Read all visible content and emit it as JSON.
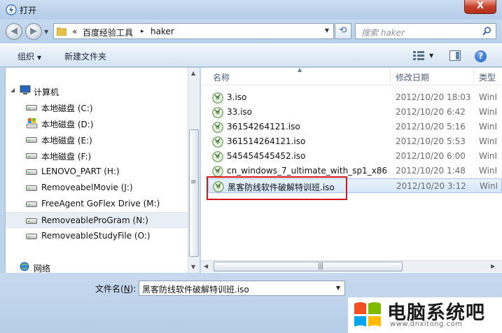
{
  "window": {
    "title": "打开",
    "close_glyph": "X"
  },
  "address": {
    "prefix": "«",
    "crumbs": [
      "百度经验工具",
      "haker"
    ],
    "separator": "▸",
    "search_placeholder": "搜索 haker"
  },
  "toolbar": {
    "organize_label": "组织",
    "new_folder_label": "新建文件夹",
    "help_glyph": "?"
  },
  "nav": {
    "computer": "计算机",
    "drives": [
      "本地磁盘 (C:)",
      "本地磁盘 (D:)",
      "本地磁盘 (E:)",
      "本地磁盘 (F:)",
      "LENOVO_PART (H:)",
      "RemoveabelMovie (J:)",
      "FreeAgent GoFlex Drive (M:)",
      "RemoveableProGram (N:)",
      "RemoveableStudyFile (O:)"
    ],
    "network": "网络"
  },
  "columns": {
    "name": "名称",
    "date": "修改日期",
    "type": "类型"
  },
  "files": [
    {
      "name": "3.iso",
      "date": "2012/10/20 18:03",
      "type": "WinI"
    },
    {
      "name": "33.iso",
      "date": "2012/10/20 6:42",
      "type": "WinI"
    },
    {
      "name": "36154264121.iso",
      "date": "2012/10/20 5:16",
      "type": "WinI"
    },
    {
      "name": "361514264121.iso",
      "date": "2012/10/20 5:53",
      "type": "WinI"
    },
    {
      "name": "545454545452.iso",
      "date": "2012/10/20 6:00",
      "type": "WinI"
    },
    {
      "name": "cn_windows_7_ultimate_with_sp1_x86_...",
      "date": "2012/10/20 1:48",
      "type": "WinI"
    },
    {
      "name": "黑客防线软件破解特训班.iso",
      "date": "2012/10/20 3:12",
      "type": "WinI"
    }
  ],
  "filename": {
    "label_prefix": "文件名(",
    "label_key": "N",
    "label_suffix": "):",
    "value": "黑客防线软件破解特训班.iso"
  },
  "watermark": {
    "title": "电脑系统吧",
    "url": "www.dnxitong.com"
  },
  "colors": {
    "selection": "#d6e6f9",
    "highlight_border": "#d4161a",
    "chrome": "#bcd3ea"
  }
}
